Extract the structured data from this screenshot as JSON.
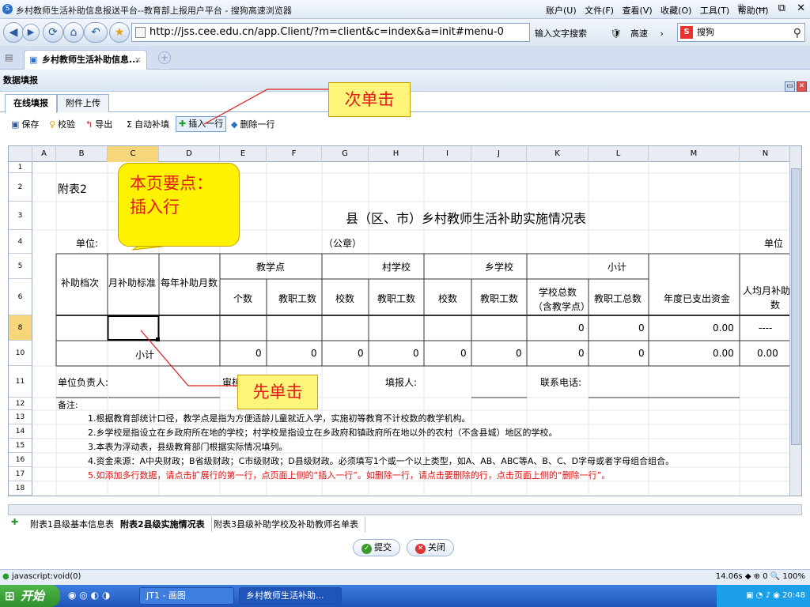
{
  "window": {
    "title": "乡村教师生活补助信息报送平台--教育部上报用户平台 - 搜狗高速浏览器",
    "menus": [
      "账户(U)",
      "文件(F)",
      "查看(V)",
      "收藏(O)",
      "工具(T)",
      "帮助(H)"
    ],
    "controls": [
      "♕",
      "—",
      "⧉",
      "✕"
    ]
  },
  "nav": {
    "url": "http://jss.cee.edu.cn/app.Client/?m=client&c=index&a=init#menu-0",
    "mid_text": "输入文字搜索",
    "speed_label": "高速",
    "search_placeholder": "搜狗"
  },
  "tab": {
    "label": "乡村教师生活补助信息..."
  },
  "panel": {
    "title": "数据填报",
    "subtabs": [
      "在线填报",
      "附件上传"
    ]
  },
  "toolbar": {
    "save": "保存",
    "check": "校验",
    "export": "导出",
    "autofill": "自动补填",
    "insert_row": "插入一行",
    "delete_row": "删除一行"
  },
  "sheet": {
    "col_headers": [
      "A",
      "B",
      "C",
      "D",
      "E",
      "F",
      "G",
      "H",
      "I",
      "J",
      "K",
      "L",
      "M",
      "N"
    ],
    "row_headers": [
      "1",
      "2",
      "3",
      "4",
      "5",
      "6",
      "8",
      "10",
      "11",
      "12",
      "13",
      "14",
      "15",
      "16",
      "17",
      "18"
    ],
    "appendix": "附表2",
    "title": "县（区、市）乡村教师生活补助实施情况表",
    "unit_label": "单位:",
    "seal": "（公章）",
    "unit_right": "单位",
    "headers": {
      "level": "补助档次",
      "monthly_std": "月补助标准",
      "yearly_months": "每年补助月数",
      "teaching_point": "教学点",
      "village_school": "村学校",
      "town_school": "乡学校",
      "subtotal": "小计",
      "count": "个数",
      "staff": "教职工数",
      "schools": "校数",
      "school_total": "学校总数",
      "incl_tp": "（含教学点）",
      "staff_total": "教职工总数",
      "spent": "年度已支出资金",
      "per_capita": "人均月补助",
      "per_capita2": "数"
    },
    "row8": {
      "k": "0",
      "l": "0",
      "m": "0.00",
      "n": "----"
    },
    "row10": {
      "label": "小计",
      "e": "0",
      "f": "0",
      "g": "0",
      "h": "0",
      "i": "0",
      "j": "0",
      "k": "0",
      "l": "0",
      "m": "0.00",
      "n": "0.00"
    },
    "row11": {
      "head": "单位负责人:",
      "reviewer": "审核",
      "filler": "填报人:",
      "phone": "联系电话:"
    },
    "notes_label": "备注:",
    "notes": [
      "1.根据教育部统计口径，教学点是指为方便适龄儿童就近入学，实施初等教育不计校数的教学机构。",
      "2.乡学校是指设立在乡政府所在地的学校；村学校是指设立在乡政府和镇政府所在地以外的农村（不含县城）地区的学校。",
      "3.本表为浮动表，县级教育部门根据实际情况填列。",
      "4.资金来源：A中央财政；B省级财政；C市级财政；D县级财政。必须填写1个或一个以上类型，如A、AB、ABC等A、B、C、D字母或者字母组合组合。",
      "5.如添加多行数据，请点击扩展行的第一行，点页面上侧的“插入一行”。如删除一行，请点击要删除的行，点击页面上侧的“删除一行”。"
    ]
  },
  "sheet_tabs": [
    "附表1县级基本信息表",
    "附表2县级实施情况表",
    "附表3县级补助学校及补助教师名单表"
  ],
  "actions": {
    "submit": "提交",
    "close": "关闭"
  },
  "status": {
    "left": "javascript:void(0)",
    "right": "14.06s   ◆ ⊕ 0  🔍 100%"
  },
  "taskbar": {
    "start": "开始",
    "items": [
      "JT1 - 画图",
      "乡村教师生活补助..."
    ],
    "clock": "20:48"
  },
  "callouts": {
    "second": "次单击",
    "first": "先单击",
    "key_line1": "本页要点：",
    "key_line2": "插入行"
  },
  "colors": {
    "callout_fill": "#fff57a",
    "callout_text": "#e21a1a",
    "selected_header": "#f7d67b",
    "note_red": "#e01010"
  }
}
